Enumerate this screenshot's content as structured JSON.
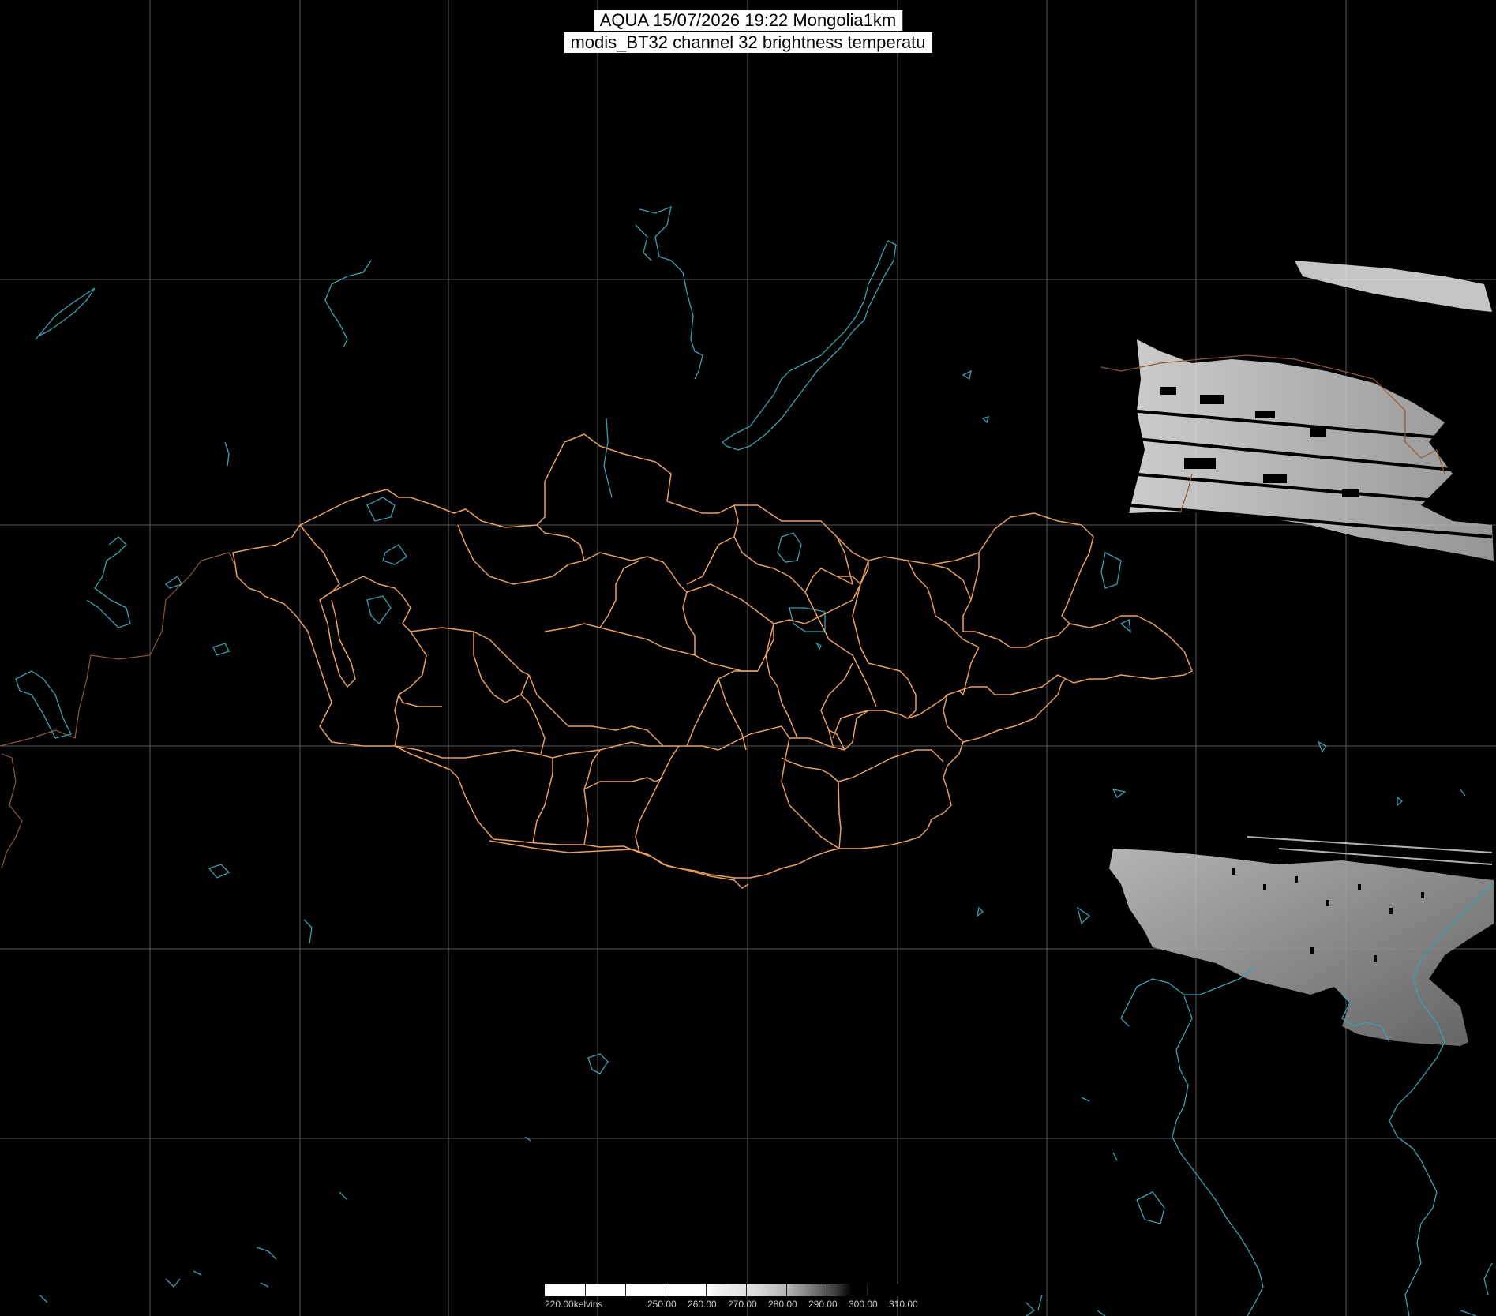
{
  "header": {
    "line1": "AQUA 15/07/2026 19:22 Mongolia1km",
    "line2": "modis_BT32 channel 32 brightness temperatu"
  },
  "colorbar": {
    "first_label": "220.00kelvins",
    "labels": [
      "250.00",
      "260.00",
      "270.00",
      "280.00",
      "290.00",
      "300.00",
      "310.00"
    ],
    "range_min": 220,
    "range_max": 320
  },
  "colors": {
    "background": "#000000",
    "graticule": "#5a5a5a",
    "mongolia_borders": "#e8a060",
    "coast_water": "#3aa0b0",
    "neighbor_borders": "#8a5a3a",
    "cloud": "#e6e6e6"
  },
  "layers": [
    "graticule",
    "coastlines-and-lakes",
    "province-borders",
    "cloud-imagery"
  ]
}
